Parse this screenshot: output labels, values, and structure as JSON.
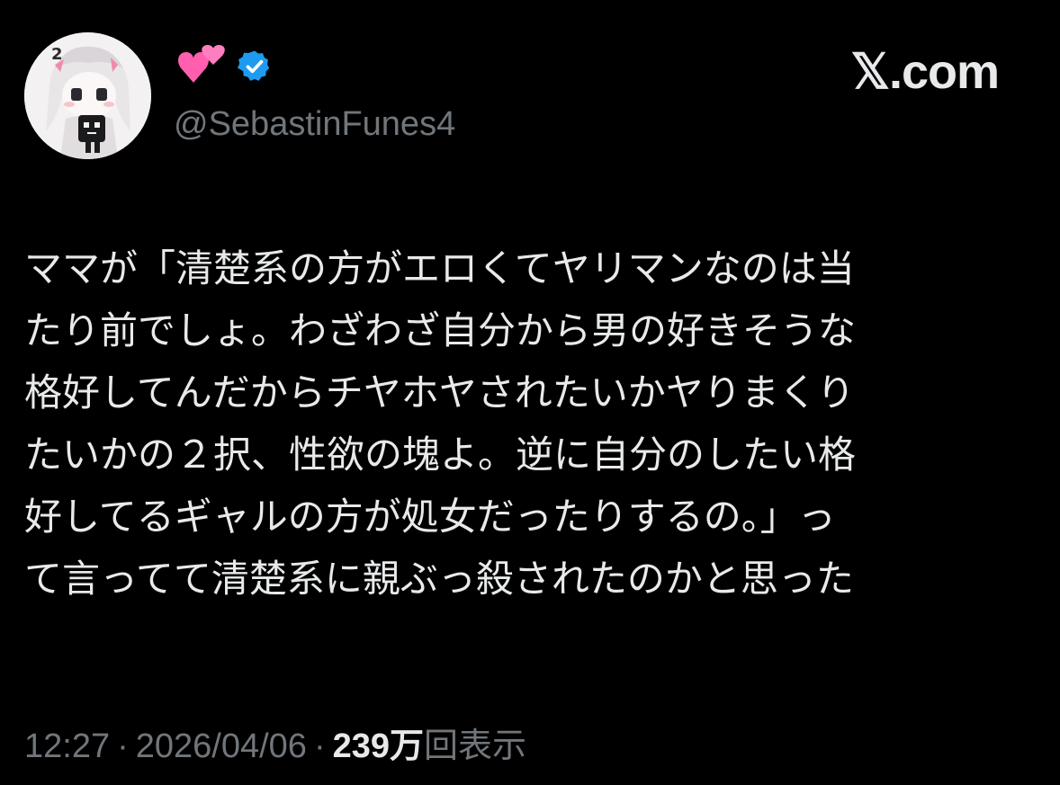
{
  "header": {
    "avatar_icon": "anime-character-avatar",
    "display_name_emoji": "💕",
    "verified_icon": "verified-badge-icon",
    "verified_color": "#1d9bf0",
    "handle": "@SebastinFunes4",
    "site_logo": "𝕏.com"
  },
  "tweet": {
    "lines": [
      "ママが「清楚系の方がエロくてヤリマンなのは当",
      "たり前でしょ。わざわざ自分から男の好きそうな",
      "格好してんだからチヤホヤされたいかヤりまくり",
      "たいかの２択、性欲の塊よ。逆に自分のしたい格",
      "好してるギャルの方が処女だったりするの。」っ",
      "て言ってて清楚系に親ぶっ殺されたのかと思った"
    ]
  },
  "meta": {
    "time": "12:27",
    "separator": "·",
    "date": "2026/04/06",
    "views_count": "239万",
    "views_label": "回表示"
  },
  "colors": {
    "background": "#000000",
    "text_primary": "#e7e9ea",
    "text_secondary": "#71767b",
    "accent": "#1d9bf0"
  }
}
